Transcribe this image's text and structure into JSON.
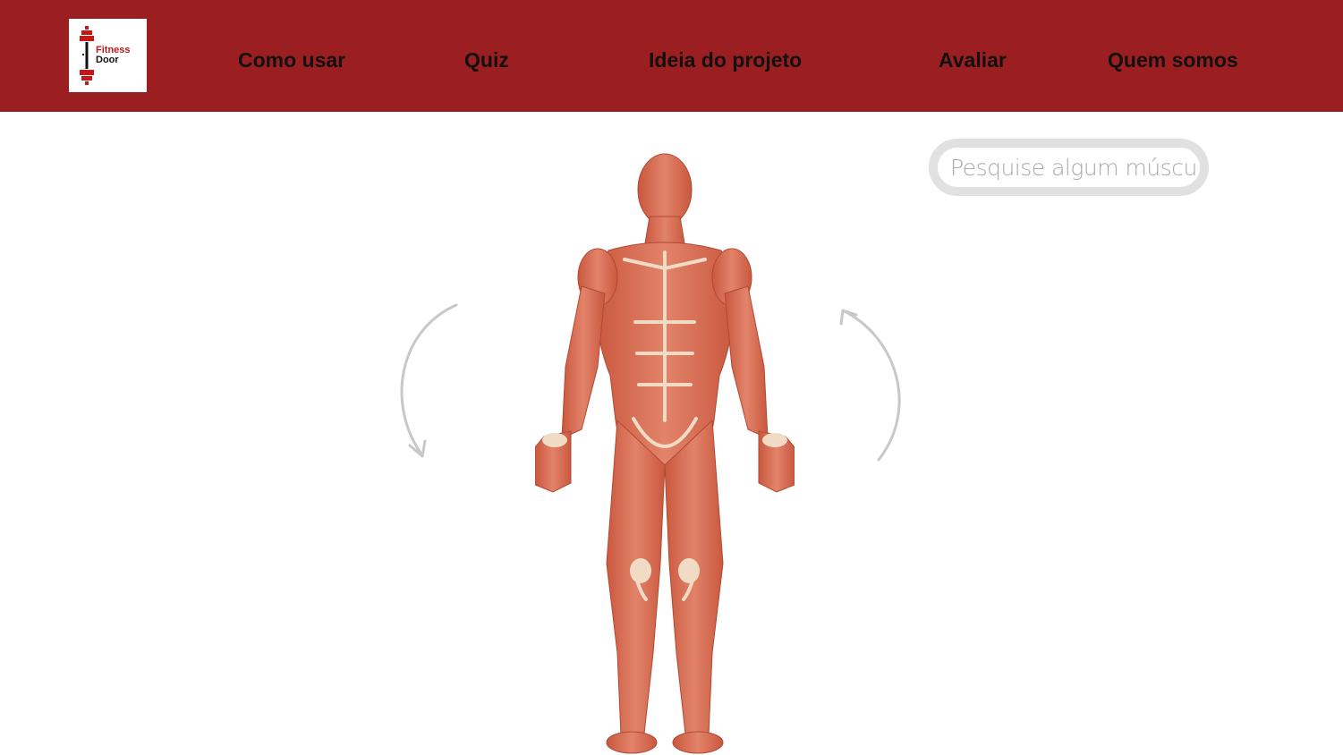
{
  "header": {
    "logo": {
      "line1": "Fitness",
      "line2": "Door",
      "accent_color": "#c0191b"
    },
    "background_color": "#9b1f20",
    "nav": [
      {
        "label": "Como usar"
      },
      {
        "label": "Quiz"
      },
      {
        "label": "Ideia do projeto"
      },
      {
        "label": "Avaliar"
      },
      {
        "label": "Quem somos"
      }
    ]
  },
  "search": {
    "placeholder": "Pesquise algum músculo",
    "value": ""
  },
  "viewer": {
    "image": "human-muscle-anatomy-front-view",
    "rotate_left_icon": "rotate-left-arrow-icon",
    "rotate_right_icon": "rotate-right-arrow-icon"
  }
}
